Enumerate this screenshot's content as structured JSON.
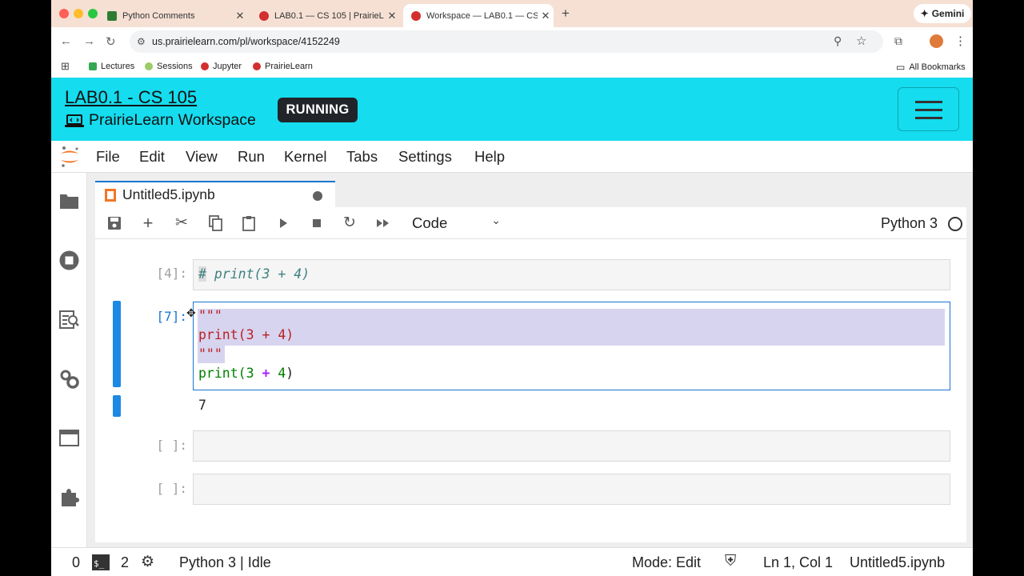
{
  "browser": {
    "tabs": [
      {
        "title": "Python Comments",
        "favicon_color": "#2e7d32"
      },
      {
        "title": "LAB0.1 — CS 105 | PrairieLearn",
        "favicon_color": "#d32f2f"
      },
      {
        "title": "Workspace — LAB0.1 — CS 105",
        "favicon_color": "#d32f2f"
      }
    ],
    "gemini_label": "Gemini",
    "url": "us.prairielearn.com/pl/workspace/4152249",
    "bookmarks": [
      "Lectures",
      "Sessions",
      "Jupyter",
      "PrairieLearn"
    ],
    "all_bookmarks": "All Bookmarks"
  },
  "pl_header": {
    "title": "LAB0.1 - CS 105",
    "subtitle": "PrairieLearn Workspace",
    "status": "RUNNING",
    "bg_color": "#15dcee"
  },
  "menu": [
    "File",
    "Edit",
    "View",
    "Run",
    "Kernel",
    "Tabs",
    "Settings",
    "Help"
  ],
  "notebook": {
    "tab_title": "Untitled5.ipynb",
    "cell_type": "Code",
    "kernel": "Python 3",
    "cells": [
      {
        "prompt": "[4]:",
        "code_lines": [
          "# print(3 + 4)"
        ]
      },
      {
        "prompt": "[7]:",
        "code_lines": [
          "\"\"\"",
          "print(3 + 4)",
          "\"\"\"",
          "print(3 + 4)"
        ],
        "output": "7"
      },
      {
        "prompt": "[ ]:",
        "code_lines": []
      },
      {
        "prompt": "[ ]:",
        "code_lines": []
      }
    ]
  },
  "statusbar": {
    "count_a": "0",
    "count_b": "2",
    "kernel_status": "Python 3 | Idle",
    "mode": "Mode: Edit",
    "position": "Ln 1, Col 1",
    "filename": "Untitled5.ipynb"
  }
}
